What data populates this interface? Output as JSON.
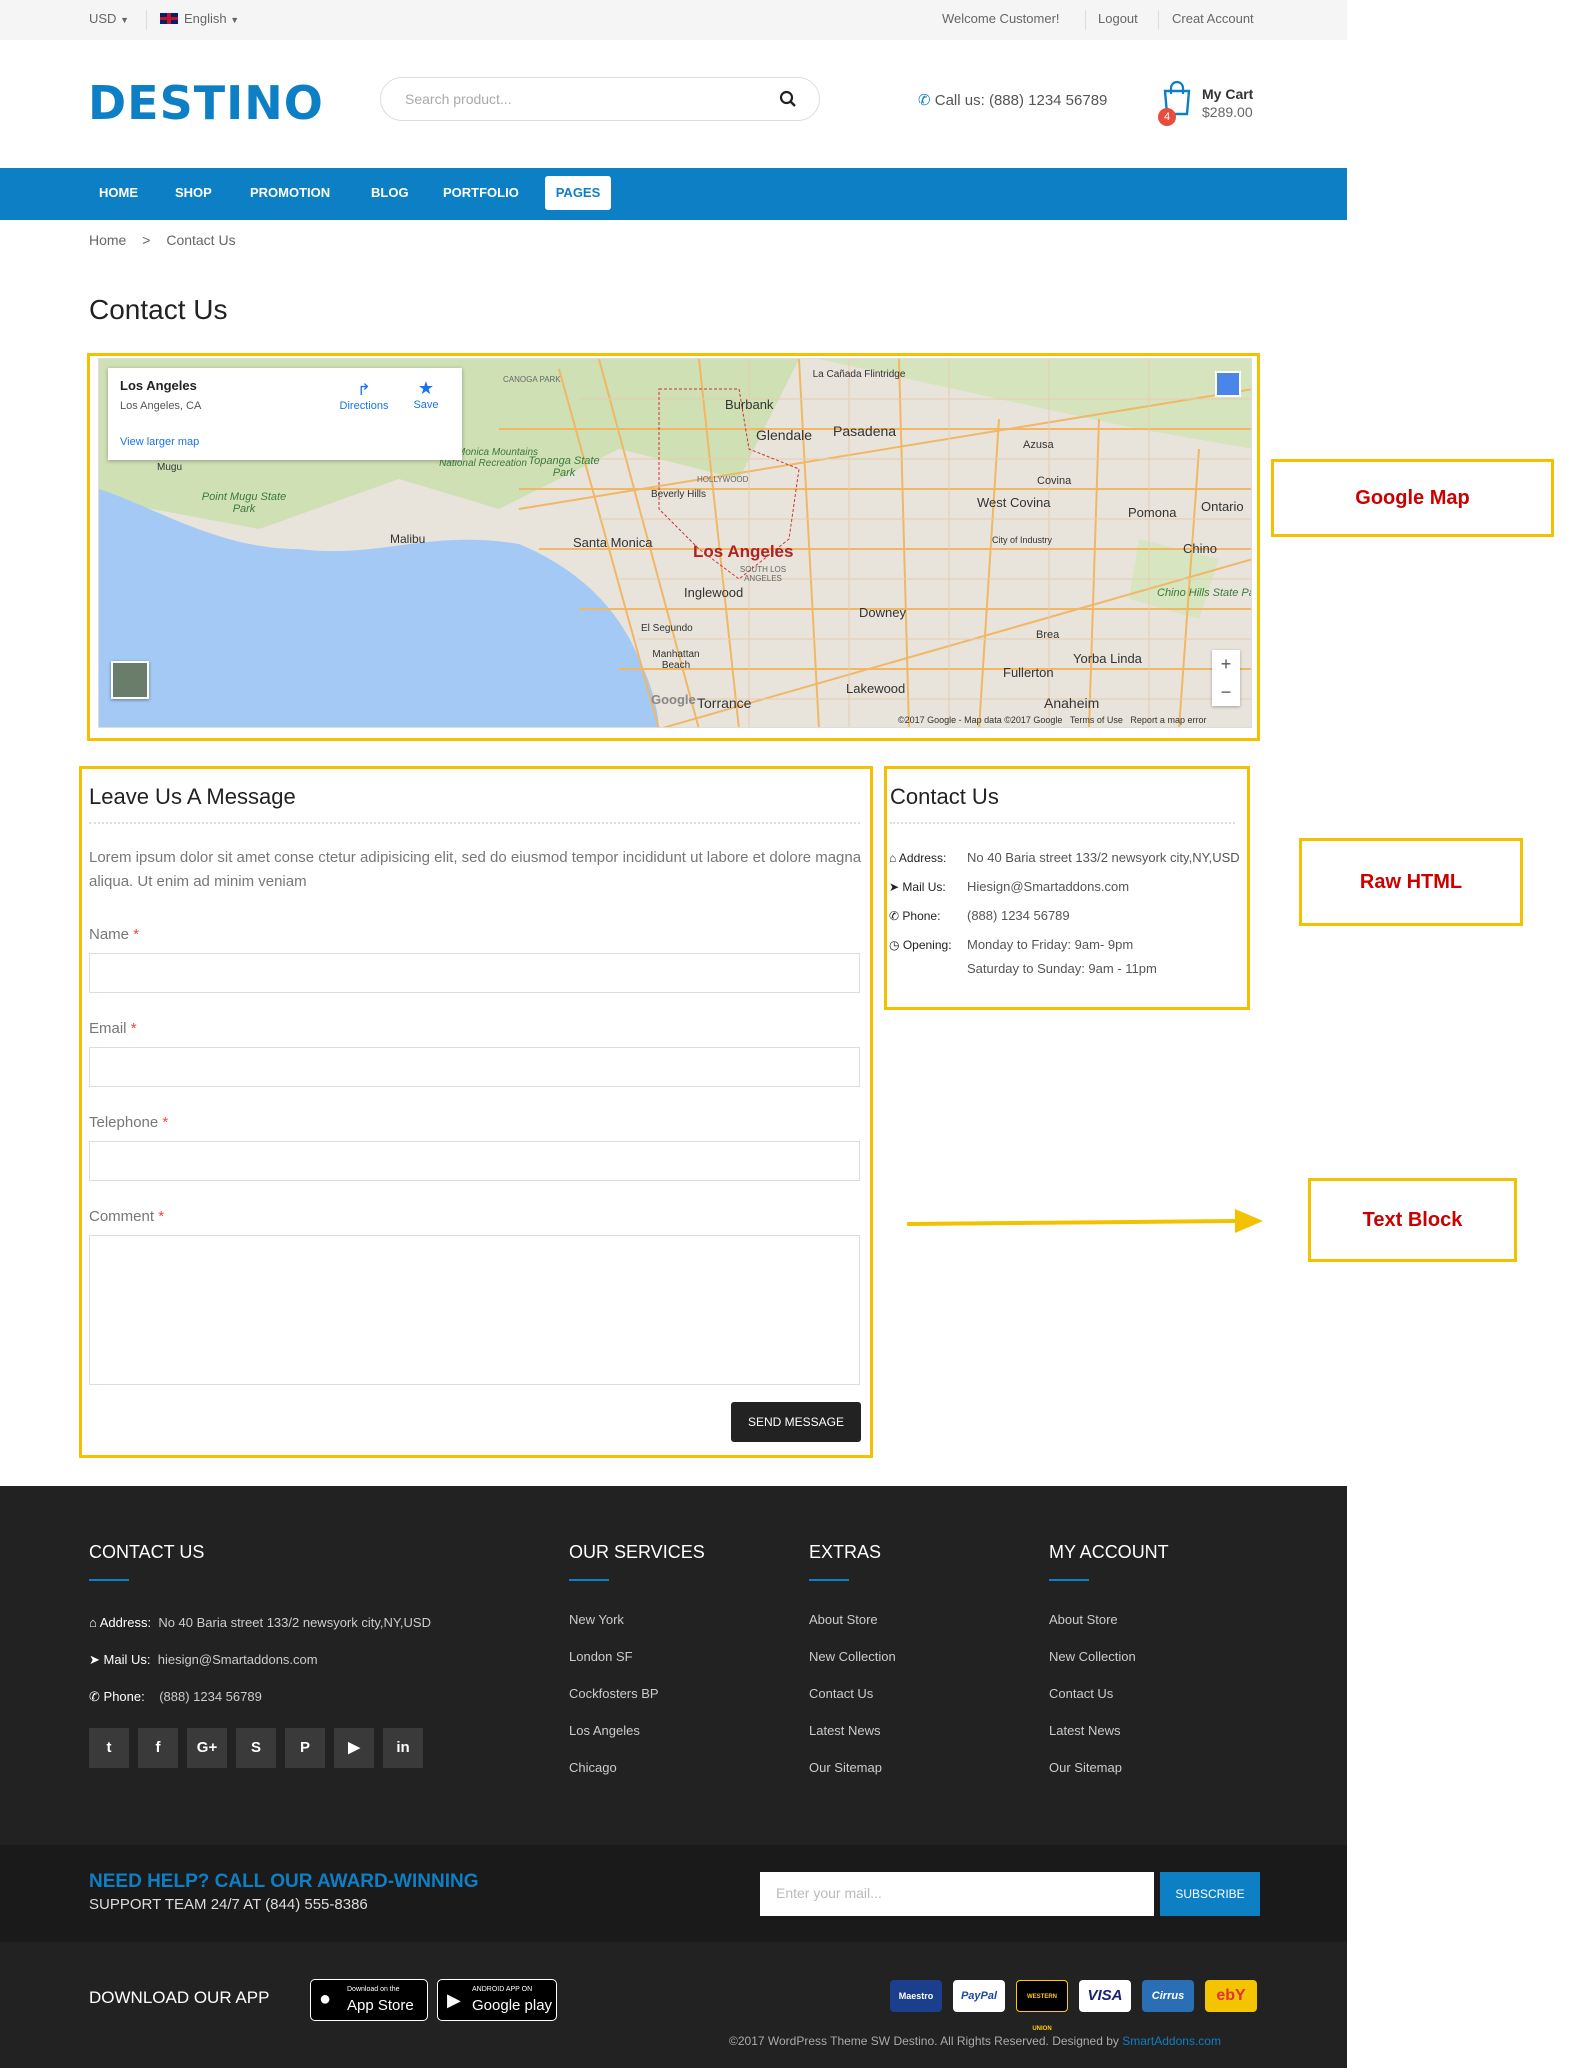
{
  "topbar": {
    "currency": "USD",
    "language": "English",
    "welcome": "Welcome Customer!",
    "logout": "Logout",
    "create_account": "Creat Account"
  },
  "header": {
    "logo": "DESTINO",
    "search_placeholder": "Search product...",
    "call_label": "Call us:",
    "phone": "(888) 1234 56789",
    "cart_label": "My Cart",
    "cart_total": "$289.00",
    "cart_count": "4"
  },
  "nav": {
    "items": [
      "HOME",
      "SHOP",
      "PROMOTION",
      "BLOG",
      "PORTFOLIO",
      "PAGES"
    ],
    "active": "PAGES"
  },
  "breadcrumb": {
    "home": "Home",
    "sep": ">",
    "current": "Contact Us"
  },
  "page_title": "Contact Us",
  "map": {
    "place": "Los Angeles",
    "place_sub": "Los Angeles, CA",
    "directions": "Directions",
    "save": "Save",
    "larger": "View larger map",
    "labels": [
      "Burbank",
      "Glendale",
      "Pasadena",
      "Los Angeles",
      "Santa Monica",
      "Inglewood",
      "Downey",
      "West Covina",
      "Pomona",
      "Ontario",
      "Chino",
      "Torrance",
      "Anaheim",
      "Fullerton",
      "Lakewood",
      "Yorba Linda",
      "Malibu",
      "Azusa",
      "Covina",
      "Brea",
      "Beverly Hills",
      "La Cañada Flintridge",
      "Chino Hills State Park",
      "City of Industry",
      "El Segundo",
      "Manhattan Beach",
      "Topanga State Park",
      "Point Mugu State Park",
      "Mugu",
      "Santa Monica Mountains National Recreation",
      "CANOGA PARK",
      "SOUTH LOS ANGELES",
      "HOLLYWOOD"
    ],
    "attribution": "©2017 Google - Map data ©2017 Google",
    "terms": "Terms of Use",
    "report": "Report a map error",
    "google": "Google",
    "zoom_in": "+",
    "zoom_out": "−"
  },
  "annotations": {
    "google_map": "Google Map",
    "raw_html": "Raw HTML",
    "text_block": "Text Block"
  },
  "form": {
    "title": "Leave Us A Message",
    "intro": "Lorem ipsum dolor sit amet conse ctetur adipisicing elit, sed do eiusmod tempor incididunt ut labore et dolore magna aliqua. Ut enim ad minim veniam",
    "name_label": "Name",
    "email_label": "Email",
    "telephone_label": "Telephone",
    "comment_label": "Comment",
    "required": "*",
    "send": "SEND MESSAGE"
  },
  "contact_info": {
    "title": "Contact Us",
    "address_label": "Address:",
    "address": "No 40 Baria street 133/2 newsyork city,NY,USD",
    "mail_label": "Mail Us:",
    "mail": "Hiesign@Smartaddons.com",
    "phone_label": "Phone:",
    "phone": "(888) 1234 56789",
    "opening_label": "Opening:",
    "opening1": "Monday to Friday: 9am- 9pm",
    "opening2": "Saturday to Sunday: 9am - 11pm"
  },
  "footer": {
    "contact_title": "CONTACT US",
    "address_label": "Address:",
    "address": "No 40 Baria street 133/2 newsyork city,NY,USD",
    "mail_label": "Mail Us:",
    "mail": "hiesign@Smartaddons.com",
    "phone_label": "Phone:",
    "phone": "(888) 1234 56789",
    "social": [
      "twitter",
      "facebook",
      "google-plus",
      "skype",
      "pinterest",
      "youtube",
      "linkedin"
    ],
    "services_title": "OUR SERVICES",
    "services": [
      "New York",
      "London SF",
      "Cockfosters BP",
      "Los Angeles",
      "Chicago"
    ],
    "extras_title": "EXTRAS",
    "extras": [
      "About Store",
      "New Collection",
      "Contact Us",
      "Latest News",
      "Our Sitemap"
    ],
    "account_title": "MY ACCOUNT",
    "account": [
      "About Store",
      "New Collection",
      "Contact Us",
      "Latest News",
      "Our Sitemap"
    ],
    "help_line1": "NEED HELP? CALL OUR AWARD-WINNING",
    "help_line2": "SUPPORT TEAM 24/7 AT (844) 555-8386",
    "mail_placeholder": "Enter your mail...",
    "subscribe": "SUBSCRIBE",
    "download": "DOWNLOAD OUR APP",
    "appstore_small": "Download on the",
    "appstore": "App Store",
    "gplay_small": "ANDROID APP ON",
    "gplay": "Google play",
    "payments": [
      "Maestro",
      "PayPal",
      "WESTERN UNION",
      "VISA",
      "Cirrus",
      "ebY"
    ],
    "copyright": "©2017 WordPress Theme SW Destino. All Rights Reserved. Designed by",
    "designer": "SmartAddons.com"
  },
  "colors": {
    "brand": "#0d7fc4",
    "annotation": "#f2c200",
    "annotation_text": "#cc0000",
    "footer_bg": "#222222"
  }
}
